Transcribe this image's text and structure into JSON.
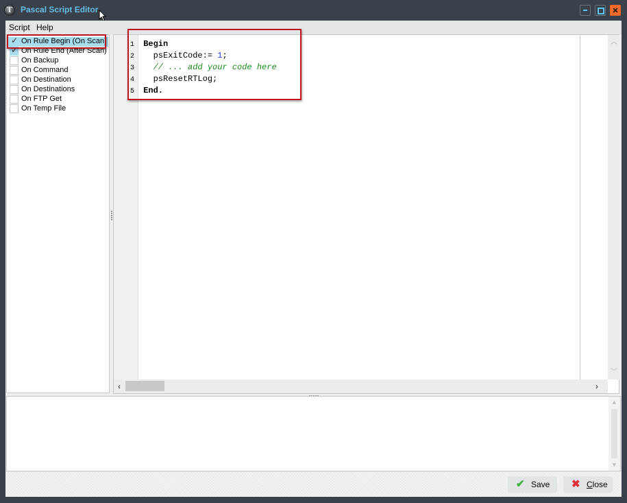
{
  "window": {
    "title": "Pascal Script Editor",
    "icon": "app-logo-icon",
    "controls": [
      "minimize-icon",
      "maximize-icon",
      "close-icon"
    ],
    "colors": {
      "title": "#65bde6",
      "frame": "#3b414b",
      "close_button": "#f2692a",
      "highlight": "#c0141c",
      "selection": "#a8dcef"
    }
  },
  "menu": {
    "items": [
      {
        "label": "Script"
      },
      {
        "label": "Help"
      }
    ]
  },
  "events": {
    "items": [
      {
        "label": "On Rule Begin (On Scan)",
        "checked": true,
        "selected": true
      },
      {
        "label": "On Rule End (After Scan)",
        "checked": true,
        "selected": false
      },
      {
        "label": "On Backup",
        "checked": false,
        "selected": false
      },
      {
        "label": "On Command",
        "checked": false,
        "selected": false
      },
      {
        "label": "On Destination",
        "checked": false,
        "selected": false
      },
      {
        "label": "On Destinations",
        "checked": false,
        "selected": false
      },
      {
        "label": "On FTP Get",
        "checked": false,
        "selected": false
      },
      {
        "label": "On Temp File",
        "checked": false,
        "selected": false
      }
    ]
  },
  "editor": {
    "lines": [
      {
        "num": "1",
        "indent": "",
        "tokens": [
          {
            "text": "Begin",
            "type": "keyword"
          }
        ]
      },
      {
        "num": "2",
        "indent": "  ",
        "tokens": [
          {
            "text": "psExitCode:= ",
            "type": "plain"
          },
          {
            "text": "1",
            "type": "number"
          },
          {
            "text": ";",
            "type": "plain"
          }
        ]
      },
      {
        "num": "3",
        "indent": "  ",
        "tokens": [
          {
            "text": "// ... add your code here",
            "type": "comment"
          }
        ]
      },
      {
        "num": "4",
        "indent": "  ",
        "tokens": [
          {
            "text": "psResetRTLog;",
            "type": "plain"
          }
        ]
      },
      {
        "num": "5",
        "indent": "",
        "tokens": [
          {
            "text": "End.",
            "type": "keyword"
          }
        ]
      }
    ]
  },
  "output": {
    "text": ""
  },
  "footer": {
    "save_label": "Save",
    "close_label_underlined": "C",
    "close_label_rest": "lose"
  }
}
